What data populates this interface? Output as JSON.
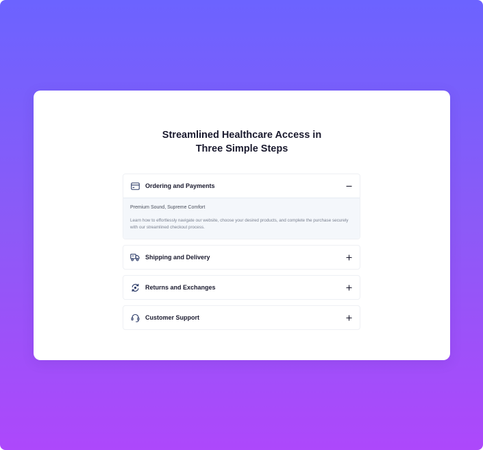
{
  "colors": {
    "gradient_top": "#6c63ff",
    "gradient_bottom": "#ad48fb",
    "card": "#ffffff",
    "text": "#1a1a2e",
    "panel_bg": "#f4f7fb",
    "icon": "#2b3a67"
  },
  "section": {
    "title_line1": "Streamlined Healthcare Access in",
    "title_line2": "Three Simple Steps"
  },
  "faq": {
    "items": [
      {
        "label": "Ordering and Payments",
        "icon": "credit-card-icon",
        "expanded": true,
        "toggle_icon": "minus-icon",
        "subtitle": "Premium Sound, Supreme Comfort",
        "body": "Learn how to effortlessly navigate our website, choose your desired products, and complete the purchase securely with our streamlined checkout process."
      },
      {
        "label": "Shipping and Delivery",
        "icon": "truck-icon",
        "expanded": false,
        "toggle_icon": "plus-icon"
      },
      {
        "label": "Returns and Exchanges",
        "icon": "refresh-icon",
        "expanded": false,
        "toggle_icon": "plus-icon"
      },
      {
        "label": "Customer Support",
        "icon": "headset-icon",
        "expanded": false,
        "toggle_icon": "plus-icon"
      }
    ]
  }
}
